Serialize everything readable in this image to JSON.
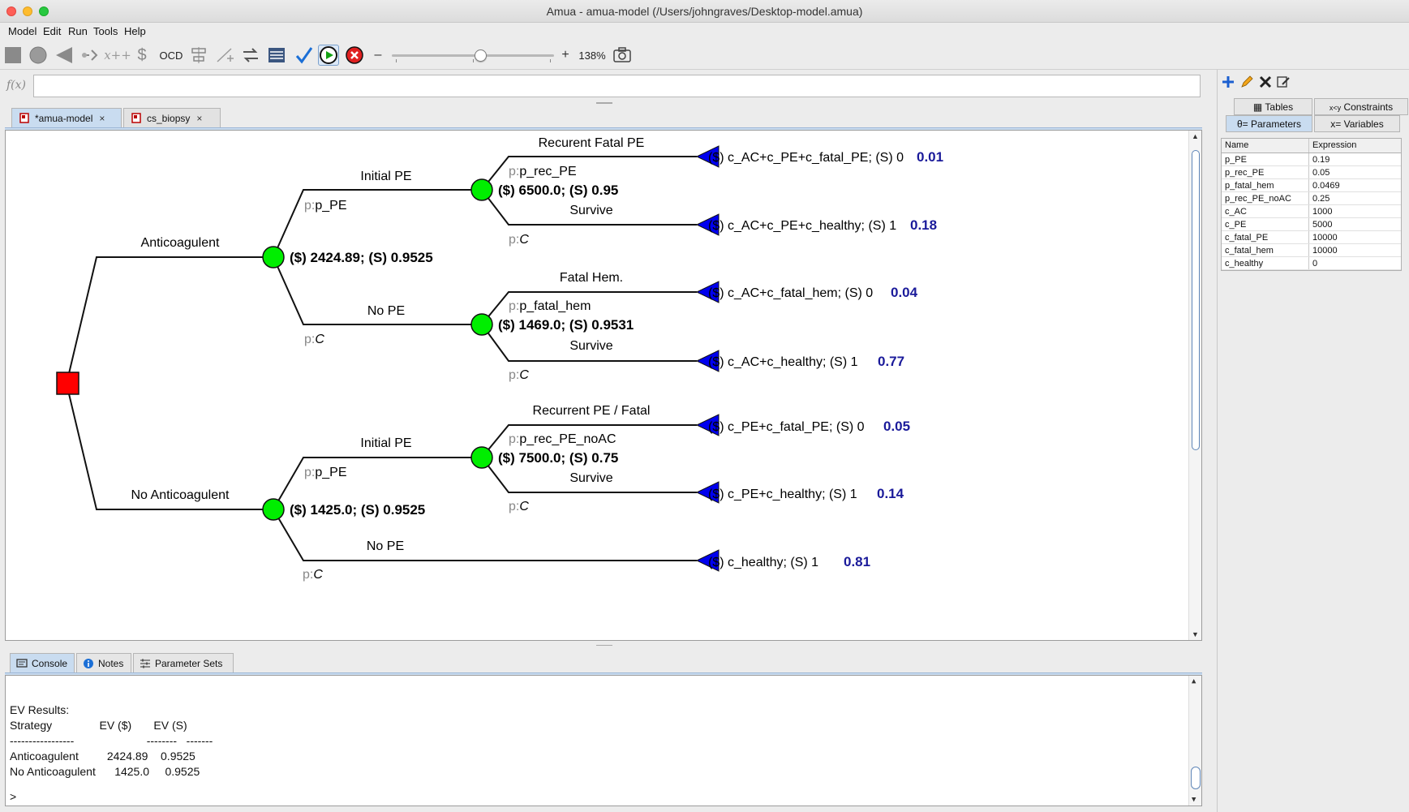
{
  "window": {
    "title": "Amua - amua-model (/Users/johngraves/Desktop-model.amua)"
  },
  "menu": [
    "Model",
    "Edit",
    "Run",
    "Tools",
    "Help"
  ],
  "toolbar": {
    "ocd_label": "OCD",
    "zoom_minus": "–",
    "zoom_plus": "+",
    "zoom_level": "138%",
    "zoom_fraction": 0.55
  },
  "formula": {
    "label": "f(x)",
    "value": ""
  },
  "tabs": [
    {
      "label": "*amua-model",
      "close": "×",
      "active": true
    },
    {
      "label": "cs_biopsy",
      "close": "×",
      "active": false
    }
  ],
  "tree": {
    "branches": [
      {
        "label": "Anticoagulent",
        "ev": "($) 2424.89; (S) 0.9525"
      },
      {
        "label": "No Anticoagulent",
        "ev": "($) 1425.0; (S) 0.9525"
      }
    ],
    "chance_labels": {
      "ac_initial": "Initial PE",
      "ac_initial_p": "p_PE",
      "ac_nope": "No PE",
      "ac_nope_p": "C",
      "nac_initial": "Initial PE",
      "nac_initial_p": "p_PE",
      "nac_nope": "No PE",
      "nac_nope_p": "C",
      "p_prefix": "p:"
    },
    "sub_nodes": [
      {
        "ev": "($) 6500.0; (S) 0.95",
        "top_label": "Recurent Fatal PE",
        "top_p": "p_rec_PE",
        "bottom_label": "Survive",
        "bottom_p": "C"
      },
      {
        "ev": "($) 1469.0; (S) 0.9531",
        "top_label": "Fatal Hem.",
        "top_p": "p_fatal_hem",
        "bottom_label": "Survive",
        "bottom_p": "C"
      },
      {
        "ev": "($) 7500.0; (S) 0.75",
        "top_label": "Recurrent PE / Fatal",
        "top_p": "p_rec_PE_noAC",
        "bottom_label": "Survive",
        "bottom_p": "C"
      }
    ],
    "terminals": [
      {
        "payoff": "($) c_AC+c_PE+c_fatal_PE; (S) 0",
        "prob": "0.01"
      },
      {
        "payoff": "($) c_AC+c_PE+c_healthy; (S) 1",
        "prob": "0.18"
      },
      {
        "payoff": "($) c_AC+c_fatal_hem; (S) 0",
        "prob": "0.04"
      },
      {
        "payoff": "($) c_AC+c_healthy; (S) 1",
        "prob": "0.77"
      },
      {
        "payoff": "($) c_PE+c_fatal_PE; (S) 0",
        "prob": "0.05"
      },
      {
        "payoff": "($) c_PE+c_healthy; (S) 1",
        "prob": "0.14"
      },
      {
        "payoff": "($) c_healthy; (S) 1",
        "prob": "0.81"
      }
    ],
    "colors": {
      "decision": "#ff0000",
      "chance": "#00ee00",
      "terminal": "#0000ee",
      "prob": "#1a1a9a"
    }
  },
  "bottom_tabs": [
    {
      "label": "Console",
      "active": true
    },
    {
      "label": "Notes",
      "active": false
    },
    {
      "label": "Parameter Sets",
      "active": false
    }
  ],
  "console": {
    "lines": [
      "EV Results:",
      "Strategy               EV ($)       EV (S)",
      "-----------------                       --------   -------",
      "Anticoagulent         2424.89    0.9525",
      "No Anticoagulent      1425.0     0.9525",
      "",
      ">"
    ]
  },
  "right_panel": {
    "tabs": [
      {
        "label": "Tables",
        "active": false
      },
      {
        "label": "Constraints",
        "active": false
      },
      {
        "label": "θ= Parameters",
        "active": true
      },
      {
        "label": "x= Variables",
        "active": false
      }
    ],
    "constraints_prefix": "x<y",
    "headers": {
      "name": "Name",
      "expr": "Expression"
    },
    "params": [
      {
        "name": "p_PE",
        "expr": "0.19"
      },
      {
        "name": "p_rec_PE",
        "expr": "0.05"
      },
      {
        "name": "p_fatal_hem",
        "expr": "0.0469"
      },
      {
        "name": "p_rec_PE_noAC",
        "expr": "0.25"
      },
      {
        "name": "c_AC",
        "expr": "1000"
      },
      {
        "name": "c_PE",
        "expr": "5000"
      },
      {
        "name": "c_fatal_PE",
        "expr": "10000"
      },
      {
        "name": "c_fatal_hem",
        "expr": "10000"
      },
      {
        "name": "c_healthy",
        "expr": "0"
      }
    ]
  }
}
